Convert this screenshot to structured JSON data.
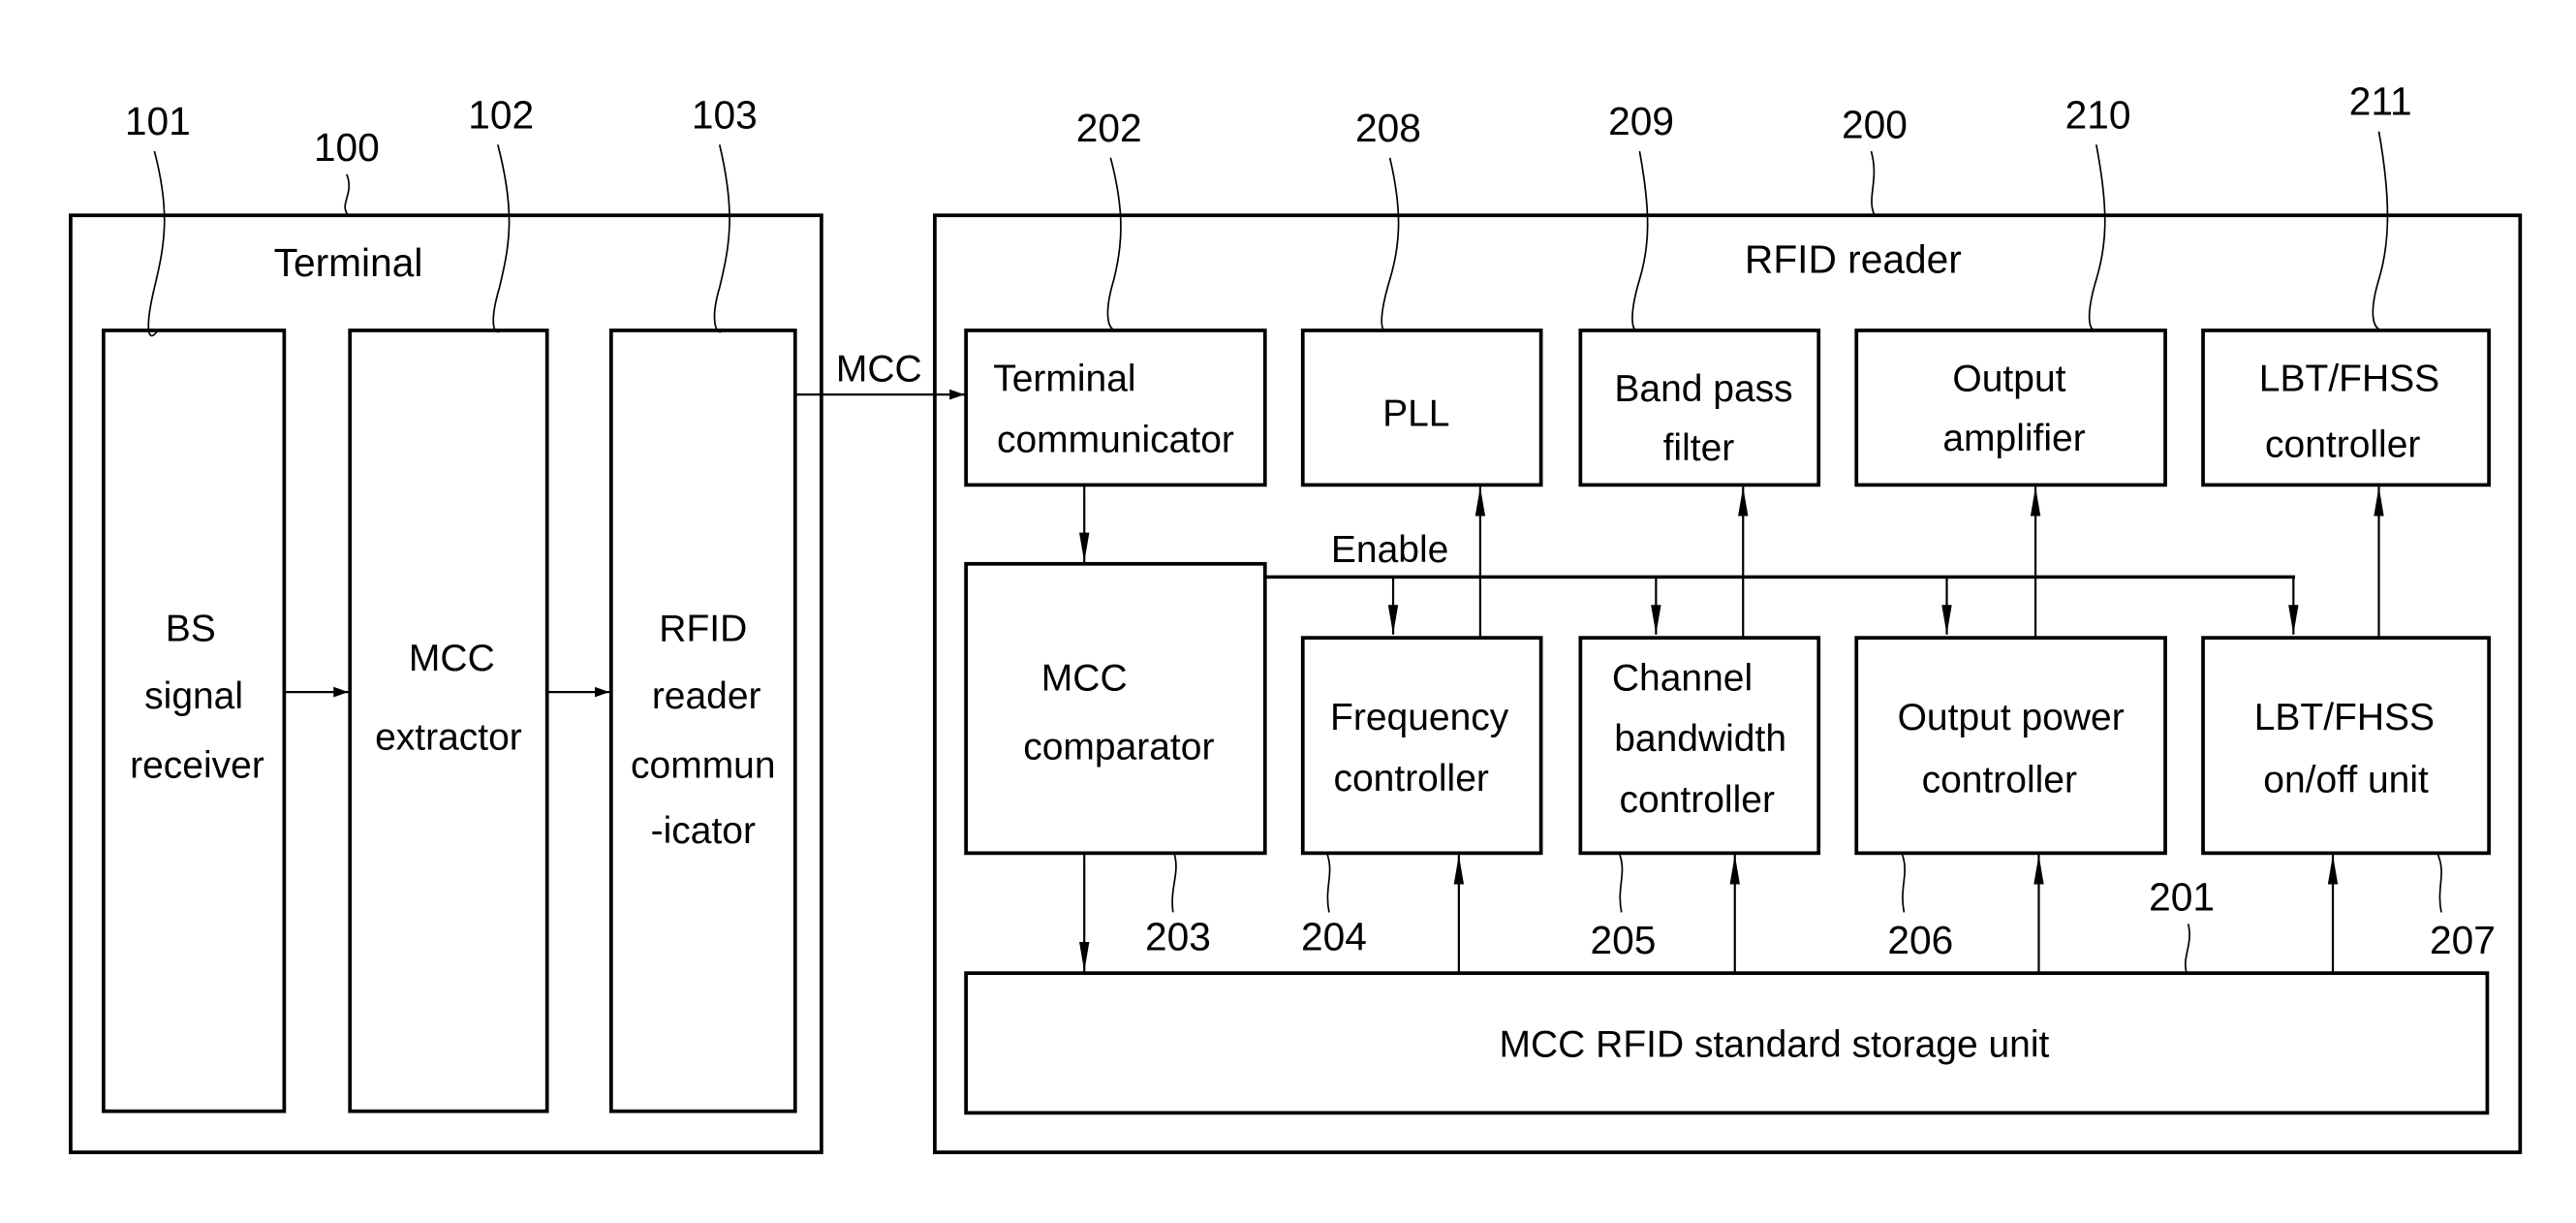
{
  "diagram": {
    "terminal": {
      "ref": "100",
      "title": "Terminal",
      "blocks": [
        {
          "ref": "101",
          "lines": [
            "BS",
            "signal",
            "receiver"
          ]
        },
        {
          "ref": "102",
          "lines": [
            "MCC",
            "extractor"
          ]
        },
        {
          "ref": "103",
          "lines": [
            "RFID",
            "reader",
            "commun",
            "-icator"
          ]
        }
      ]
    },
    "link_label": "MCC",
    "rfid_reader": {
      "ref": "200",
      "title": "RFID reader",
      "top_row": [
        {
          "ref": "202",
          "lines": [
            "Terminal",
            "communicator"
          ]
        },
        {
          "ref": "208",
          "lines": [
            "PLL"
          ]
        },
        {
          "ref": "209",
          "lines": [
            "Band pass",
            "filter"
          ]
        },
        {
          "ref": "210",
          "lines": [
            "Output",
            "amplifier"
          ]
        },
        {
          "ref": "211",
          "lines": [
            "LBT/FHSS",
            "controller"
          ]
        }
      ],
      "comparator": {
        "ref": "203",
        "lines": [
          "MCC",
          "comparator"
        ]
      },
      "enable_label": "Enable",
      "mid_row": [
        {
          "ref": "204",
          "lines": [
            "Frequency",
            "controller"
          ]
        },
        {
          "ref": "205",
          "lines": [
            "Channel",
            "bandwidth",
            "controller"
          ]
        },
        {
          "ref": "206",
          "lines": [
            "Output power",
            "controller"
          ]
        },
        {
          "ref": "207",
          "lines": [
            "LBT/FHSS",
            "on/off unit"
          ]
        }
      ],
      "storage": {
        "ref": "201",
        "label": "MCC RFID standard storage unit"
      }
    }
  }
}
